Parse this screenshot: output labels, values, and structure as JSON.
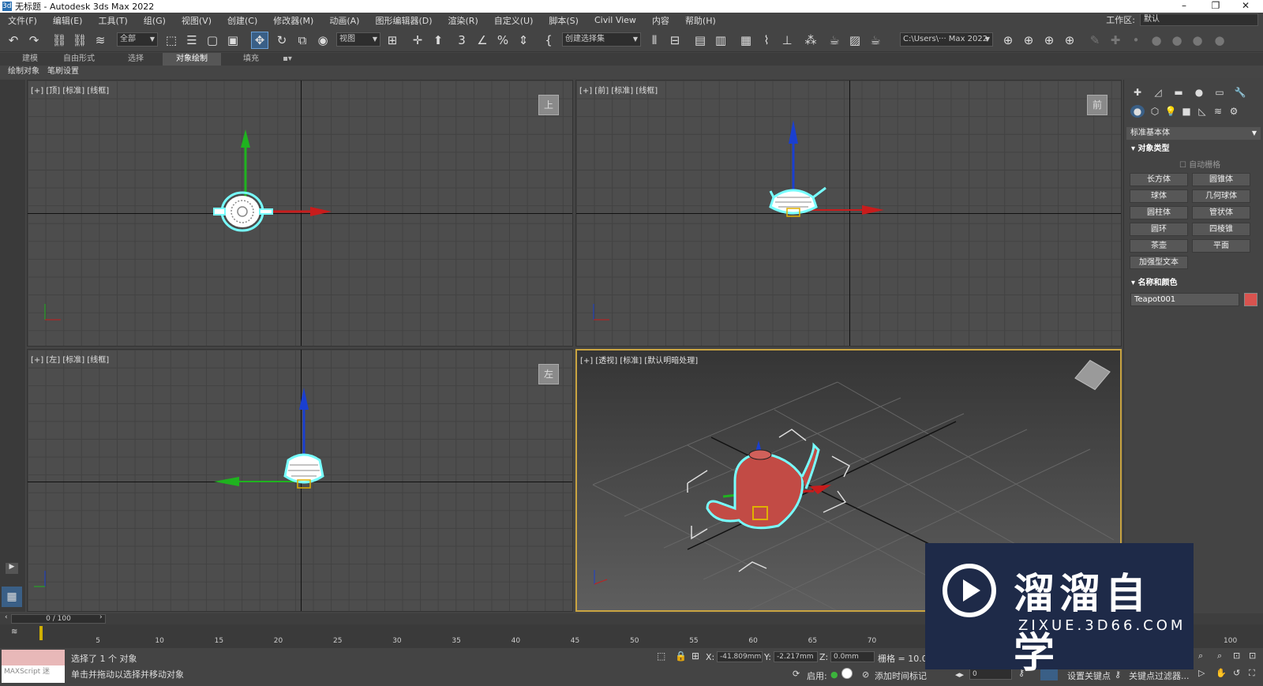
{
  "window": {
    "icon": "3ds",
    "title": "无标题 - Autodesk 3ds Max 2022",
    "minimize": "–",
    "maximize": "❐",
    "close": "✕"
  },
  "menu": [
    "文件(F)",
    "编辑(E)",
    "工具(T)",
    "组(G)",
    "视图(V)",
    "创建(C)",
    "修改器(M)",
    "动画(A)",
    "图形编辑器(D)",
    "渲染(R)",
    "自定义(U)",
    "脚本(S)",
    "Civil View",
    "内容",
    "帮助(H)"
  ],
  "workspace": {
    "label": "工作区:",
    "value": "默认"
  },
  "toolbar": {
    "selection_filter": "全部",
    "ref_coord": "视图",
    "named_selection": "创建选择集",
    "project_path": "C:\\Users\\··· Max 2022",
    "icons": [
      "undo-icon",
      "redo-icon",
      "link-icon",
      "unlink-icon",
      "bind-space-warp-icon",
      "select-object-icon",
      "select-by-name-icon",
      "rect-select-icon",
      "window-crossing-icon",
      "move-icon",
      "rotate-icon",
      "scale-icon",
      "place-icon",
      "pivot-icon",
      "snap-icon",
      "angle-snap-icon",
      "percent-snap-icon",
      "spinner-snap-icon",
      "edit-named-sets-icon",
      "mirror-icon",
      "align-icon",
      "layer-icon",
      "scene-explorer-icon",
      "graphite-icon",
      "curve-editor-icon",
      "schematic-icon",
      "material-editor-icon",
      "render-setup-icon",
      "rendered-frame-icon",
      "render-icon"
    ]
  },
  "ribbon": {
    "tabs": [
      "建模",
      "自由形式",
      "选择",
      "对象绘制",
      "填充"
    ],
    "active": "对象绘制",
    "sub": [
      "绘制对象",
      "笔刷设置"
    ]
  },
  "viewports": [
    {
      "label": "[+] [顶] [标准] [线框]",
      "cube": "上"
    },
    {
      "label": "[+] [前] [标准] [线框]",
      "cube": "前"
    },
    {
      "label": "[+] [左] [标准] [线框]",
      "cube": "左"
    },
    {
      "label": "[+] [透视] [标准] [默认明暗处理]",
      "cube": ""
    }
  ],
  "command_panel": {
    "dropdown": "标准基本体",
    "section_object_type": "对象类型",
    "autogrid": "自动栅格",
    "buttons": [
      "长方体",
      "圆锥体",
      "球体",
      "几何球体",
      "圆柱体",
      "管状体",
      "圆环",
      "四棱锥",
      "茶壶",
      "平面",
      "加强型文本"
    ],
    "section_name_color": "名称和颜色",
    "object_name": "Teapot001",
    "object_color": "#d9534f"
  },
  "timeline": {
    "position": "0 / 100",
    "ticks": [
      "0",
      "5",
      "10",
      "15",
      "20",
      "25",
      "30",
      "35",
      "40",
      "45",
      "50",
      "55",
      "60",
      "65",
      "70",
      "75",
      "80",
      "85",
      "90",
      "95",
      "100"
    ]
  },
  "status": {
    "selected": "选择了 1 个 对象",
    "prompt": "单击并拖动以选择并移动对象",
    "script_label": "MAXScript 迷",
    "x_label": "X:",
    "x": "-41.809mm",
    "y_label": "Y:",
    "y": "-2.217mm",
    "z_label": "Z:",
    "z": "0.0mm",
    "grid": "栅格 = 10.0mm",
    "enable": "启用:",
    "add_time_tag": "添加时间标记",
    "frame": "0",
    "set_key": "设置关键点",
    "key_filters": "关键点过滤器..."
  },
  "watermark": {
    "title": "溜溜自学",
    "url": "ZIXUE.3D66.COM"
  }
}
